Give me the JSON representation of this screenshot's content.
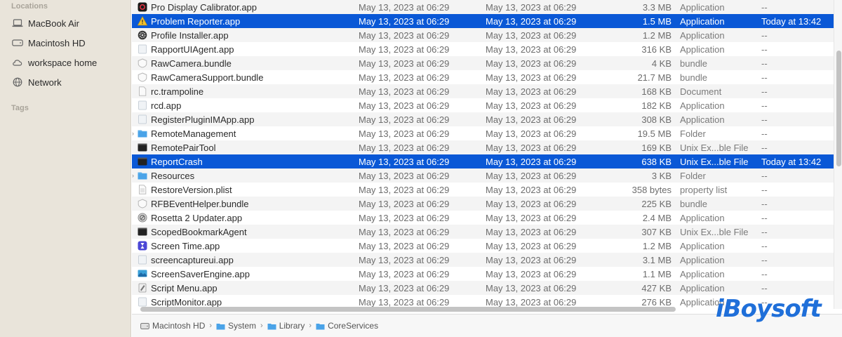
{
  "sidebar": {
    "locations_header": "Locations",
    "items": [
      {
        "label": "MacBook Air",
        "icon": "laptop-icon"
      },
      {
        "label": "Macintosh HD",
        "icon": "disk-icon"
      },
      {
        "label": "workspace home",
        "icon": "network-drive-icon"
      },
      {
        "label": "Network",
        "icon": "globe-icon"
      }
    ],
    "tags_header": "Tags"
  },
  "files": [
    {
      "name": "Pro Display Calibrator.app",
      "modified": "May 13, 2023 at 06:29",
      "created": "May 13, 2023 at 06:29",
      "size": "3.3 MB",
      "kind": "Application",
      "last_opened": "--",
      "icon": "app-black-icon"
    },
    {
      "name": "Problem Reporter.app",
      "modified": "May 13, 2023 at 06:29",
      "created": "May 13, 2023 at 06:29",
      "size": "1.5 MB",
      "kind": "Application",
      "last_opened": "Today at 13:42",
      "icon": "warning-triangle-icon",
      "selected": true
    },
    {
      "name": "Profile Installer.app",
      "modified": "May 13, 2023 at 06:29",
      "created": "May 13, 2023 at 06:29",
      "size": "1.2 MB",
      "kind": "Application",
      "last_opened": "--",
      "icon": "gear-app-icon"
    },
    {
      "name": "RapportUIAgent.app",
      "modified": "May 13, 2023 at 06:29",
      "created": "May 13, 2023 at 06:29",
      "size": "316 KB",
      "kind": "Application",
      "last_opened": "--",
      "icon": "generic-app-icon"
    },
    {
      "name": "RawCamera.bundle",
      "modified": "May 13, 2023 at 06:29",
      "created": "May 13, 2023 at 06:29",
      "size": "4 KB",
      "kind": "bundle",
      "last_opened": "--",
      "icon": "bundle-icon"
    },
    {
      "name": "RawCameraSupport.bundle",
      "modified": "May 13, 2023 at 06:29",
      "created": "May 13, 2023 at 06:29",
      "size": "21.7 MB",
      "kind": "bundle",
      "last_opened": "--",
      "icon": "bundle-icon"
    },
    {
      "name": "rc.trampoline",
      "modified": "May 13, 2023 at 06:29",
      "created": "May 13, 2023 at 06:29",
      "size": "168 KB",
      "kind": "Document",
      "last_opened": "--",
      "icon": "document-icon"
    },
    {
      "name": "rcd.app",
      "modified": "May 13, 2023 at 06:29",
      "created": "May 13, 2023 at 06:29",
      "size": "182 KB",
      "kind": "Application",
      "last_opened": "--",
      "icon": "generic-app-icon"
    },
    {
      "name": "RegisterPluginIMApp.app",
      "modified": "May 13, 2023 at 06:29",
      "created": "May 13, 2023 at 06:29",
      "size": "308 KB",
      "kind": "Application",
      "last_opened": "--",
      "icon": "generic-app-icon"
    },
    {
      "name": "RemoteManagement",
      "modified": "May 13, 2023 at 06:29",
      "created": "May 13, 2023 at 06:29",
      "size": "19.5 MB",
      "kind": "Folder",
      "last_opened": "--",
      "icon": "folder-icon",
      "folder": true
    },
    {
      "name": "RemotePairTool",
      "modified": "May 13, 2023 at 06:29",
      "created": "May 13, 2023 at 06:29",
      "size": "169 KB",
      "kind": "Unix Ex...ble File",
      "last_opened": "--",
      "icon": "terminal-icon"
    },
    {
      "name": "ReportCrash",
      "modified": "May 13, 2023 at 06:29",
      "created": "May 13, 2023 at 06:29",
      "size": "638 KB",
      "kind": "Unix Ex...ble File",
      "last_opened": "Today at 13:42",
      "icon": "terminal-icon",
      "selected": true
    },
    {
      "name": "Resources",
      "modified": "May 13, 2023 at 06:29",
      "created": "May 13, 2023 at 06:29",
      "size": "3 KB",
      "kind": "Folder",
      "last_opened": "--",
      "icon": "folder-icon",
      "folder": true
    },
    {
      "name": "RestoreVersion.plist",
      "modified": "May 13, 2023 at 06:29",
      "created": "May 13, 2023 at 06:29",
      "size": "358 bytes",
      "kind": "property list",
      "last_opened": "--",
      "icon": "plist-icon"
    },
    {
      "name": "RFBEventHelper.bundle",
      "modified": "May 13, 2023 at 06:29",
      "created": "May 13, 2023 at 06:29",
      "size": "225 KB",
      "kind": "bundle",
      "last_opened": "--",
      "icon": "bundle-icon"
    },
    {
      "name": "Rosetta 2 Updater.app",
      "modified": "May 13, 2023 at 06:29",
      "created": "May 13, 2023 at 06:29",
      "size": "2.4 MB",
      "kind": "Application",
      "last_opened": "--",
      "icon": "prohibited-app-icon"
    },
    {
      "name": "ScopedBookmarkAgent",
      "modified": "May 13, 2023 at 06:29",
      "created": "May 13, 2023 at 06:29",
      "size": "307 KB",
      "kind": "Unix Ex...ble File",
      "last_opened": "--",
      "icon": "terminal-icon"
    },
    {
      "name": "Screen Time.app",
      "modified": "May 13, 2023 at 06:29",
      "created": "May 13, 2023 at 06:29",
      "size": "1.2 MB",
      "kind": "Application",
      "last_opened": "--",
      "icon": "hourglass-icon"
    },
    {
      "name": "screencaptureui.app",
      "modified": "May 13, 2023 at 06:29",
      "created": "May 13, 2023 at 06:29",
      "size": "3.1 MB",
      "kind": "Application",
      "last_opened": "--",
      "icon": "generic-app-icon"
    },
    {
      "name": "ScreenSaverEngine.app",
      "modified": "May 13, 2023 at 06:29",
      "created": "May 13, 2023 at 06:29",
      "size": "1.1 MB",
      "kind": "Application",
      "last_opened": "--",
      "icon": "screensaver-icon"
    },
    {
      "name": "Script Menu.app",
      "modified": "May 13, 2023 at 06:29",
      "created": "May 13, 2023 at 06:29",
      "size": "427 KB",
      "kind": "Application",
      "last_opened": "--",
      "icon": "script-icon"
    },
    {
      "name": "ScriptMonitor.app",
      "modified": "May 13, 2023 at 06:29",
      "created": "May 13, 2023 at 06:29",
      "size": "276 KB",
      "kind": "Application",
      "last_opened": "--",
      "icon": "generic-app-icon"
    }
  ],
  "pathbar": {
    "crumbs": [
      {
        "label": "Macintosh HD",
        "icon": "disk-icon"
      },
      {
        "label": "System",
        "icon": "folder-icon"
      },
      {
        "label": "Library",
        "icon": "folder-icon"
      },
      {
        "label": "CoreServices",
        "icon": "folder-icon"
      }
    ],
    "separator": "›"
  },
  "watermark": "iBoysoft",
  "colors": {
    "selection": "#0a58d6",
    "sidebar_bg": "#e9e4da",
    "folder": "#4aa3e8",
    "watermark": "#1f6fd9"
  }
}
